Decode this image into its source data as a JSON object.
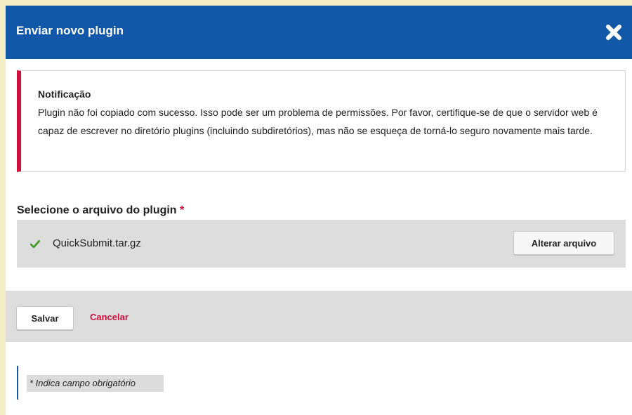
{
  "dialog": {
    "title": "Enviar novo plugin",
    "close_icon": "close-x-icon"
  },
  "notification": {
    "title": "Notificação",
    "message": "Plugin não foi copiado com sucesso. Isso pode ser um problema de permissões. Por favor, certifique-se de que o servidor web é capaz de escrever no diretório plugins (incluindo subdiretórios), mas não se esqueça de torná-lo seguro novamente mais tarde.",
    "accent_color": "#d0103a"
  },
  "file_field": {
    "label": "Selecione o arquivo do plugin",
    "required_marker": "*",
    "file_name": "QuickSubmit.tar.gz",
    "status_icon": "check-icon",
    "change_button_label": "Alterar arquivo"
  },
  "actions": {
    "save_label": "Salvar",
    "cancel_label": "Cancelar"
  },
  "footer": {
    "required_note": "* Indica campo obrigatório"
  },
  "colors": {
    "header_bg": "#1258a8",
    "page_bg": "#f3ecc4",
    "success_green": "#3a9a1e"
  }
}
